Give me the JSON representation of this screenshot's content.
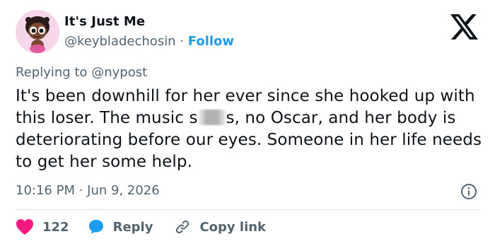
{
  "author": {
    "display_name": "It's Just Me",
    "handle": "@keybladechosin",
    "separator": "·",
    "follow_label": "Follow"
  },
  "reply_context": {
    "prefix": "Replying to",
    "mention": "@nypost"
  },
  "tweet": {
    "text_before_blur": "It's been downhill for her ever since she hooked up with this loser. The music s",
    "text_after_blur": "s, no Oscar, and her body is deteriorating before our eyes. Someone in her life needs to get her some help.",
    "timestamp": "10:16 PM · Jun 9, 2026"
  },
  "actions": {
    "like_count": "122",
    "reply_label": "Reply",
    "copy_link_label": "Copy link"
  },
  "colors": {
    "link": "#1d9bf0",
    "like": "#f91880",
    "reply": "#1d9bf0",
    "secondary_text": "#536471",
    "primary_text": "#0f1419"
  },
  "icons": [
    "x-logo-icon",
    "info-icon",
    "heart-icon",
    "reply-bubble-icon",
    "link-icon"
  ]
}
